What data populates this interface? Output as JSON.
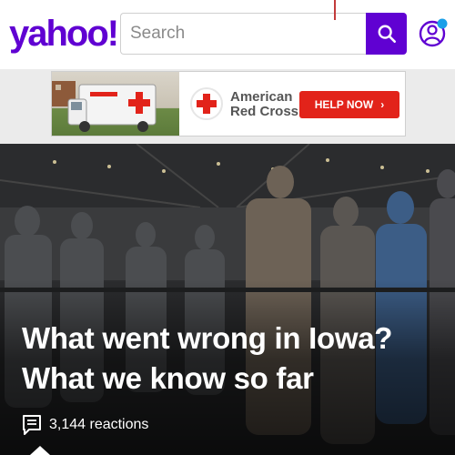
{
  "header": {
    "logo_text": "yahoo!",
    "search": {
      "placeholder": "Search",
      "value": ""
    },
    "brand_color": "#6001d2"
  },
  "ad": {
    "title": "American Red Cross",
    "cta_label": "HELP NOW",
    "cta_arrow": "›",
    "accent_color": "#e2231a",
    "choice_icon": "ad-choices-icon"
  },
  "article": {
    "headline": "What went wrong in Iowa? What we know so far",
    "reactions": "3,144 reactions",
    "reactions_icon": "comment-icon"
  },
  "icons": {
    "search": "search-icon",
    "profile": "profile-icon"
  }
}
